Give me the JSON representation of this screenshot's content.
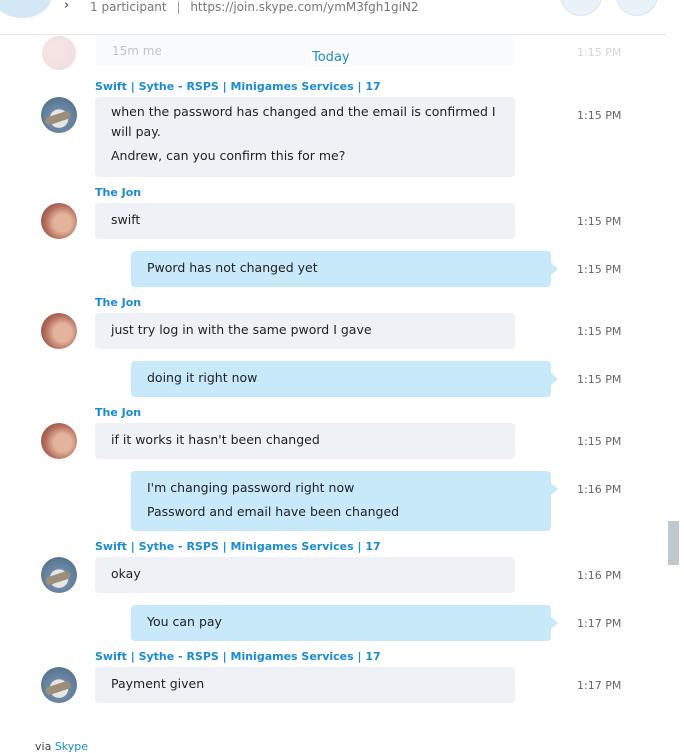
{
  "header": {
    "participants": "1 participant",
    "separator": "|",
    "join_link": "https://join.skype.com/ymM3fgh1giN2"
  },
  "faded_message": {
    "text": "15m me",
    "time": "1:15 PM"
  },
  "date_divider": "Today",
  "messages": [
    {
      "type": "in",
      "sender": "Swift | Sythe - RSPS | Minigames Services | 17",
      "lines": [
        "when the password has changed and the email is confirmed I",
        "will pay.",
        "Andrew, can you confirm this for me?"
      ],
      "time": "1:15 PM",
      "avatar": "pelican-avatar"
    },
    {
      "type": "in",
      "sender": "The Jon",
      "lines": [
        "swift"
      ],
      "time": "1:15 PM",
      "avatar": "face-avatar"
    },
    {
      "type": "out",
      "lines": [
        "Pword has not changed yet"
      ],
      "time": "1:15 PM"
    },
    {
      "type": "in",
      "sender": "The Jon",
      "lines": [
        "just try log in with the same pword I gave"
      ],
      "time": "1:15 PM",
      "avatar": "face-avatar"
    },
    {
      "type": "out",
      "lines": [
        "doing it right now"
      ],
      "time": "1:15 PM"
    },
    {
      "type": "in",
      "sender": "The Jon",
      "lines": [
        "if it works it hasn't been changed"
      ],
      "time": "1:15 PM",
      "avatar": "face-avatar"
    },
    {
      "type": "out",
      "lines": [
        "I'm changing password right now",
        "Password and email have been changed"
      ],
      "time": "1:16 PM"
    },
    {
      "type": "in",
      "sender": "Swift | Sythe - RSPS | Minigames Services | 17",
      "lines": [
        "okay"
      ],
      "time": "1:16 PM",
      "avatar": "pelican-avatar"
    },
    {
      "type": "out",
      "lines": [
        "You can pay"
      ],
      "time": "1:17 PM"
    },
    {
      "type": "in",
      "sender": "Swift | Sythe - RSPS | Minigames Services | 17",
      "lines": [
        "Payment given"
      ],
      "time": "1:17 PM",
      "avatar": "pelican-avatar"
    }
  ],
  "footer": {
    "via": "via",
    "link": "Skype"
  }
}
